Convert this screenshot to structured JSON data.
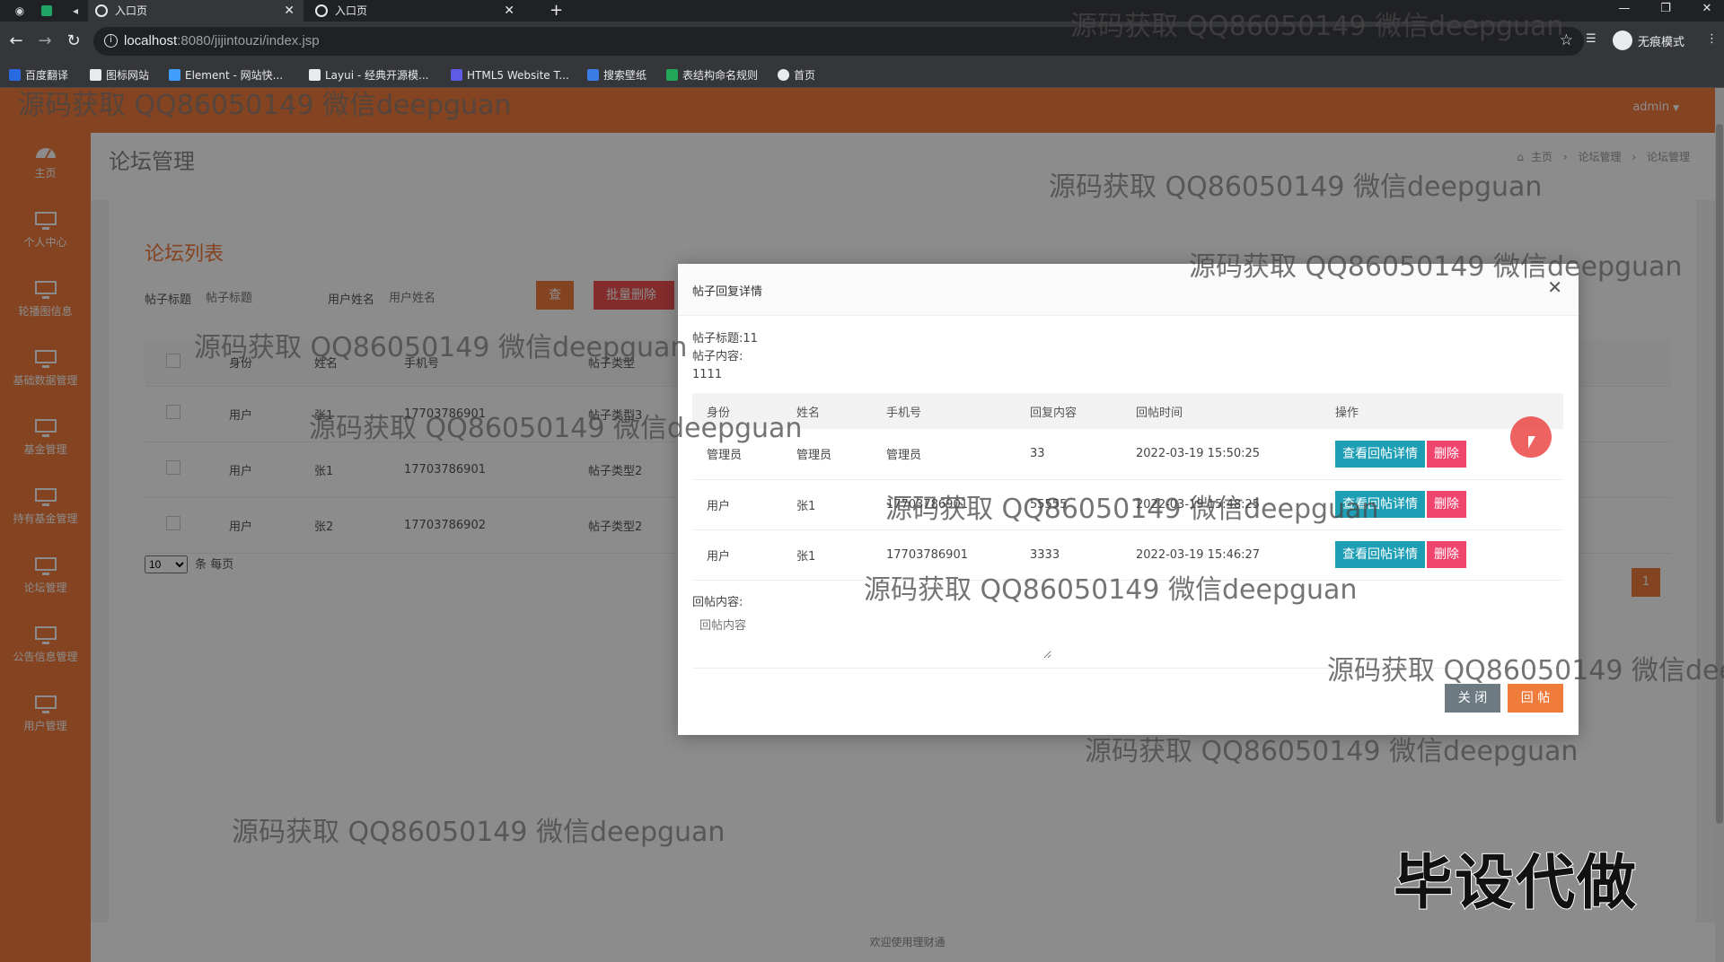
{
  "browser": {
    "tabs": [
      {
        "label": "入口页"
      },
      {
        "label": "入口页"
      }
    ],
    "url_host": "localhost",
    "url_rest": ":8080/jijintouzi/index.jsp",
    "profile_label": "无痕模式",
    "bookmarks": [
      {
        "label": "百度翻译",
        "color": "#2a6ae0"
      },
      {
        "label": "图标网站",
        "color": "#e8eaed"
      },
      {
        "label": "Element - 网站快...",
        "color": "#409eff"
      },
      {
        "label": "Layui - 经典开源模...",
        "color": "#e8eaed"
      },
      {
        "label": "HTML5 Website T...",
        "color": "#5e5ce6"
      },
      {
        "label": "搜索壁纸",
        "color": "#3a7be6"
      },
      {
        "label": "表结构命名规则",
        "color": "#22a65a"
      },
      {
        "label": "首页",
        "color": "#e8eaed"
      }
    ]
  },
  "topbar": {
    "user": "admin"
  },
  "sidebar": {
    "items": [
      {
        "label": "主页",
        "icon": "dashboard-icon"
      },
      {
        "label": "个人中心",
        "icon": "monitor-icon"
      },
      {
        "label": "轮播图信息",
        "icon": "monitor-icon"
      },
      {
        "label": "基础数据管理",
        "icon": "monitor-icon"
      },
      {
        "label": "基金管理",
        "icon": "monitor-icon"
      },
      {
        "label": "持有基金管理",
        "icon": "monitor-icon"
      },
      {
        "label": "论坛管理",
        "icon": "monitor-icon"
      },
      {
        "label": "公告信息管理",
        "icon": "monitor-icon"
      },
      {
        "label": "用户管理",
        "icon": "monitor-icon"
      }
    ]
  },
  "page": {
    "title": "论坛管理",
    "breadcrumb": [
      "主页",
      "论坛管理",
      "论坛管理"
    ],
    "list_title": "论坛列表",
    "filters": {
      "title_label": "帖子标题",
      "title_placeholder": "帖子标题",
      "user_label": "用户姓名",
      "user_placeholder": "用户姓名",
      "query_btn": "查询",
      "batch_delete_btn": "批量删除"
    },
    "table": {
      "headers": [
        "身份",
        "姓名",
        "手机号",
        "帖子类型"
      ],
      "rows": [
        [
          "用户",
          "张1",
          "17703786901",
          "帖子类型3"
        ],
        [
          "用户",
          "张1",
          "17703786901",
          "帖子类型2"
        ],
        [
          "用户",
          "张2",
          "17703786902",
          "帖子类型2"
        ]
      ]
    },
    "pager": {
      "page_size": "10",
      "per_page_label": "条 每页",
      "current_page": "1"
    },
    "footer": "欢迎使用理财通"
  },
  "modal": {
    "title": "帖子回复详情",
    "post_title_line": "帖子标题:11",
    "post_content_label": "帖子内容:",
    "post_content": "1111",
    "headers": [
      "身份",
      "姓名",
      "手机号",
      "回复内容",
      "回帖时间",
      "操作"
    ],
    "rows": [
      [
        "管理员",
        "管理员",
        "管理员",
        "33",
        "2022-03-19 15:50:25"
      ],
      [
        "用户",
        "张1",
        "17703786901",
        "55555",
        "2022-03-19 15:48:25"
      ],
      [
        "用户",
        "张1",
        "17703786901",
        "3333",
        "2022-03-19 15:46:27"
      ]
    ],
    "view_btn": "查看回帖详情",
    "delete_btn": "删除",
    "reply_label": "回帖内容:",
    "reply_placeholder": "回帖内容",
    "close_btn": "关 闭",
    "reply_btn": "回 帖"
  },
  "watermark": {
    "text": "源码获取 QQ86050149 微信deepguan",
    "big_text": "毕设代做"
  }
}
